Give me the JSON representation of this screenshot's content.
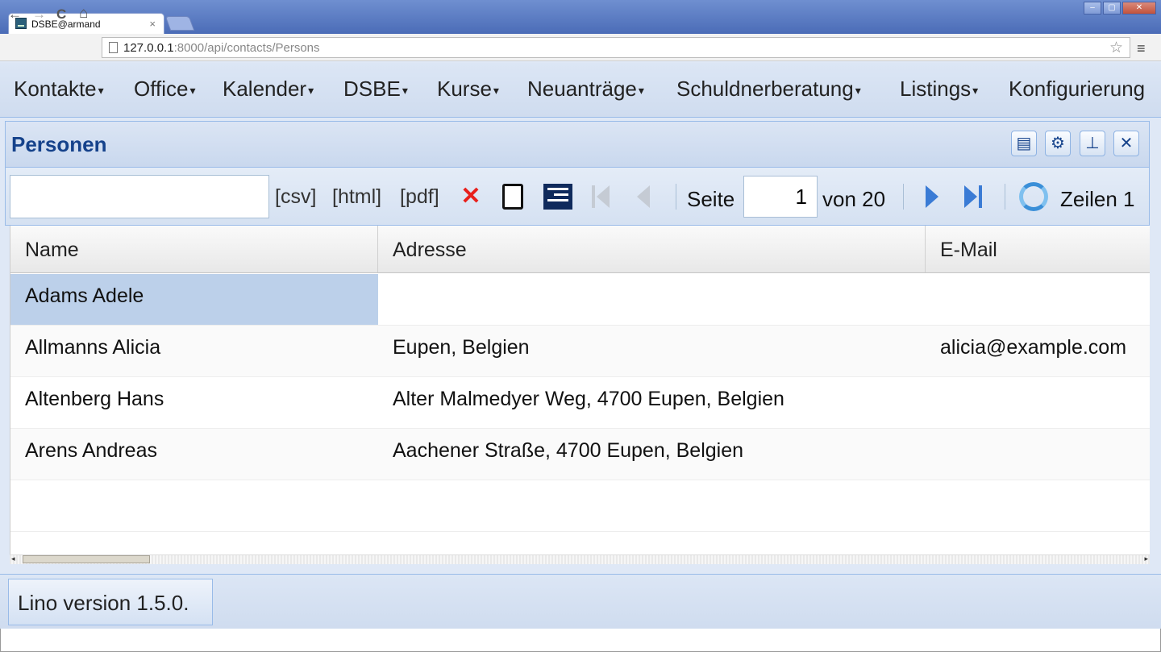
{
  "browser": {
    "tab_title": "DSBE@armand",
    "tab_close": "×",
    "url_host": "127.0.0.1",
    "url_rest": ":8000/api/contacts/Persons",
    "back": "←",
    "forward": "→",
    "reload": "C",
    "home": "⌂",
    "star": "☆",
    "menu": "≡",
    "minimize": "–",
    "maximize": "▢",
    "close": "✕"
  },
  "menubar": {
    "items": [
      {
        "label": "Kontakte"
      },
      {
        "label": "Office"
      },
      {
        "label": "Kalender"
      },
      {
        "label": "DSBE"
      },
      {
        "label": "Kurse"
      },
      {
        "label": "Neuanträge"
      },
      {
        "label": "Schuldnerberatung"
      },
      {
        "label": "Listings"
      },
      {
        "label": "Konfigurierung"
      }
    ],
    "arrow": "▾"
  },
  "panel": {
    "title": "Personen",
    "tools": {
      "save": "▤",
      "settings": "⚙",
      "pin": "⊥",
      "close": "✕"
    }
  },
  "toolbar": {
    "quick_filter_value": "",
    "csv": "[csv]",
    "html": "[html]",
    "pdf": "[pdf]",
    "delete_icon": "✕",
    "page_label": "Seite",
    "page_value": "1",
    "page_of": "von 20",
    "rows_label": "Zeilen 1"
  },
  "grid": {
    "columns": [
      "Name",
      "Adresse",
      "E-Mail"
    ],
    "rows": [
      {
        "name": "Adams Adele",
        "address": "",
        "email": ""
      },
      {
        "name": "Allmanns Alicia",
        "address": "Eupen, Belgien",
        "email": "alicia@example.com"
      },
      {
        "name": "Altenberg Hans",
        "address": "Alter Malmedyer Weg, 4700 Eupen, Belgien",
        "email": ""
      },
      {
        "name": "Arens Andreas",
        "address": "Aachener Straße, 4700 Eupen, Belgien",
        "email": ""
      }
    ]
  },
  "footer": {
    "version": "Lino version 1.5.0."
  },
  "colors": {
    "accent": "#15428b",
    "selection": "#bcd0ea",
    "delete": "#e8201c",
    "nav_blue": "#3a7bd5"
  }
}
